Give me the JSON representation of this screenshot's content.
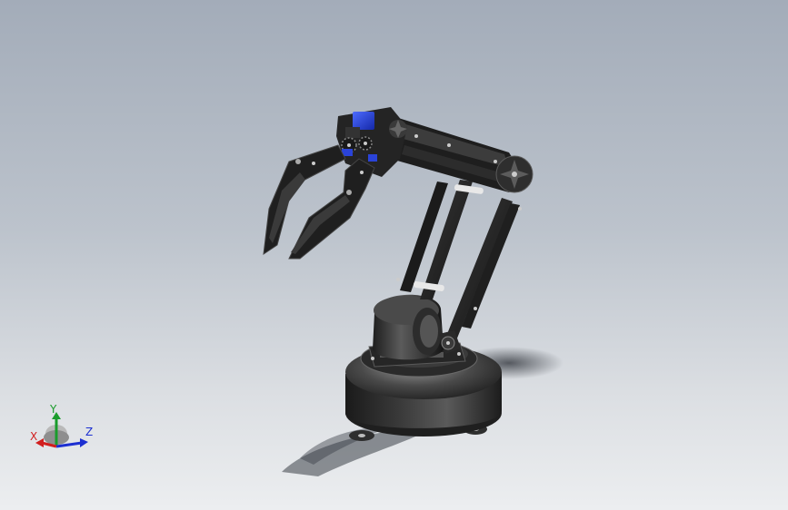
{
  "viewport": {
    "background_top": "#a3acb9",
    "background_bottom": "#eceef0"
  },
  "model": {
    "subject": "robotic-arm-with-gripper",
    "body_color": "#2b2b2b",
    "servo_color": "#1e3fe0"
  },
  "triad": {
    "x_label": "X",
    "y_label": "Y",
    "z_label": "Z",
    "x_color": "#d11f1f",
    "y_color": "#1a9c2c",
    "z_color": "#1c2fd1"
  }
}
